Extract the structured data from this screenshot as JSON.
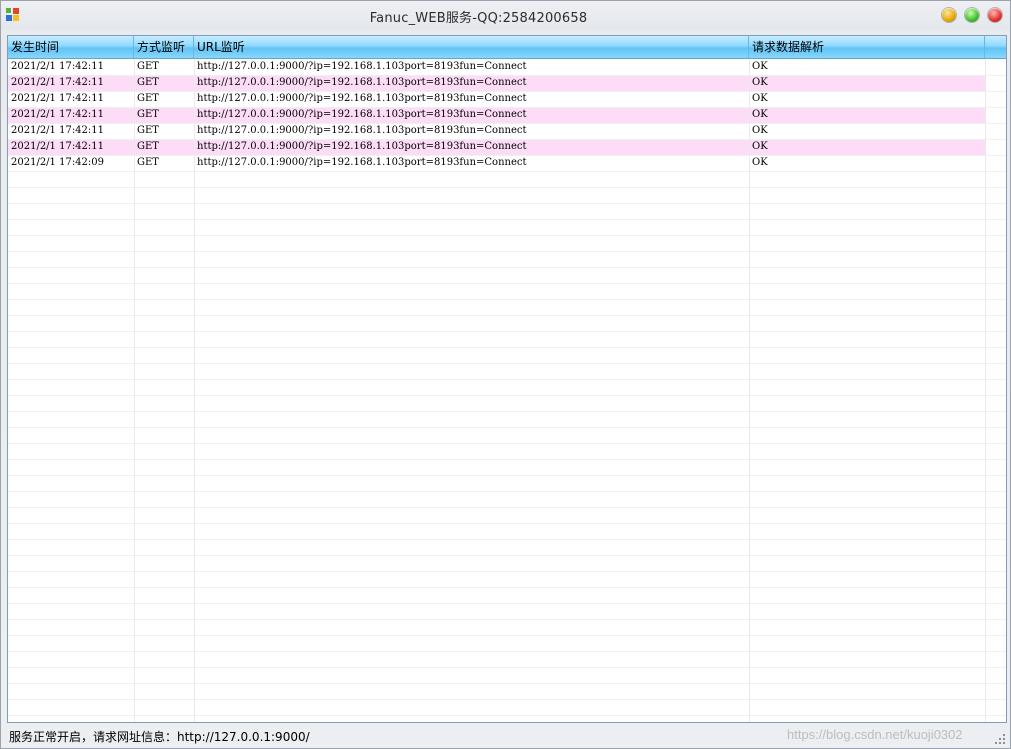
{
  "window": {
    "title": "Fanuc_WEB服务-QQ:2584200658"
  },
  "listview": {
    "columns": [
      "发生时间",
      "方式监听",
      "URL监听",
      "请求数据解析"
    ],
    "rows": [
      {
        "time": "2021/2/1 17:42:11",
        "method": "GET",
        "url": "http://127.0.0.1:9000/?ip=192.168.1.103port=8193fun=Connect",
        "result": "OK",
        "highlighted": false
      },
      {
        "time": "2021/2/1 17:42:11",
        "method": "GET",
        "url": "http://127.0.0.1:9000/?ip=192.168.1.103port=8193fun=Connect",
        "result": "OK",
        "highlighted": true
      },
      {
        "time": "2021/2/1 17:42:11",
        "method": "GET",
        "url": "http://127.0.0.1:9000/?ip=192.168.1.103port=8193fun=Connect",
        "result": "OK",
        "highlighted": false
      },
      {
        "time": "2021/2/1 17:42:11",
        "method": "GET",
        "url": "http://127.0.0.1:9000/?ip=192.168.1.103port=8193fun=Connect",
        "result": "OK",
        "highlighted": true
      },
      {
        "time": "2021/2/1 17:42:11",
        "method": "GET",
        "url": "http://127.0.0.1:9000/?ip=192.168.1.103port=8193fun=Connect",
        "result": "OK",
        "highlighted": false
      },
      {
        "time": "2021/2/1 17:42:11",
        "method": "GET",
        "url": "http://127.0.0.1:9000/?ip=192.168.1.103port=8193fun=Connect",
        "result": "OK",
        "highlighted": true
      },
      {
        "time": "2021/2/1 17:42:09",
        "method": "GET",
        "url": "http://127.0.0.1:9000/?ip=192.168.1.103port=8193fun=Connect",
        "result": "OK",
        "highlighted": false
      }
    ]
  },
  "statusbar": {
    "text": "服务正常开启，请求网址信息：http://127.0.0.1:9000/",
    "watermark": "https://blog.csdn.net/kuoji0302"
  },
  "colors": {
    "header_gradient_mid": "#5fc3f5",
    "highlight_row": "#fcdcf6"
  },
  "icons": {
    "app": "windows-flag-icon",
    "minimize": "minimize-orb-icon",
    "maximize": "maximize-orb-icon",
    "close": "close-orb-icon",
    "resize_grip": "resize-grip-icon"
  }
}
